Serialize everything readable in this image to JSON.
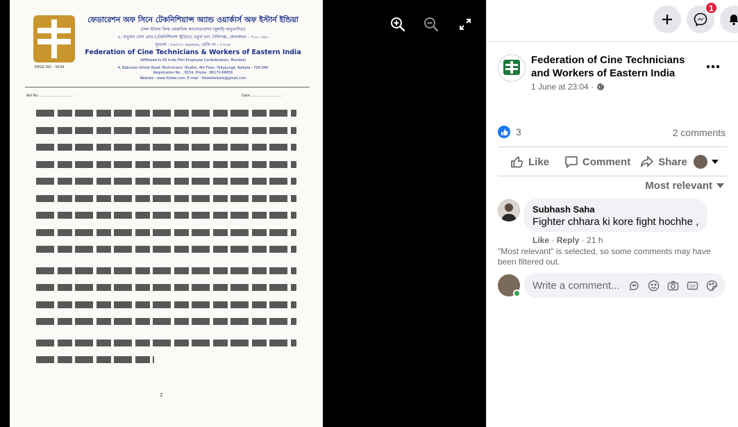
{
  "document": {
    "regd_no": "REGD NO. : 8154",
    "heading_bengali": "ফেডারেশন অফ সিনে টেকনিশিয়ান্স অ্যান্ড ওয়ার্কার্স অফ ইস্টার্ন ইন্ডিয়া",
    "heading_bengali_sub": "(অল ইন্ডিয়া ফিল্ম এমপ্লয়িজ কনফেডারেশন (মুম্বাই) অনুমোদিত)",
    "address_bengali": "৪, বাবুরাম ঘোষ রোড (টেকনিশিয়ান্স স্টুডিও), চতুর্থ তল, টালিগঞ্জ, কোলকাতা - ৭০০ ০৪০",
    "phone_bengali": "দূরভাষ : ৮৬১৭০ ৬৬৬৬৬, রেজি নং - ৮১৫৪",
    "heading_english": "Federation of Cine Technicians & Workers of Eastern India",
    "affiliation": "(Affiliated to All India Film Employee Confederation, Mumbai)",
    "address_english": "4, Baburam Ghosh Road (Technicians' Studio), 4th Floor, Tollygunge, Kolkata - 700 040",
    "registration": "Registration No. : 8154, Phone : 86170 66656",
    "website": "Website : www.fctwei.com, E-mail : fctweikolkata@gmail.com",
    "ref_no_label": "Ref No................................",
    "date_label": "Date ............................",
    "page_number": "2"
  },
  "viewer": {
    "zoom_in_icon": "zoom-in-icon",
    "zoom_out_icon": "zoom-out-icon",
    "fullscreen_icon": "expand-icon"
  },
  "topbar": {
    "messenger_badge": "1"
  },
  "post": {
    "page_name": "Federation of Cine Technicians and Workers of Eastern India",
    "timestamp": "1 June at 23:04 ·",
    "like_count": "3",
    "comment_count": "2 comments",
    "actions": {
      "like": "Like",
      "comment": "Comment",
      "share": "Share"
    },
    "sort_label": "Most relevant"
  },
  "comment": {
    "author": "Subhash Saha",
    "text": "Fighter chhara ki kore fight hochhe ,",
    "like_label": "Like",
    "reply_label": "Reply",
    "age": "21 h"
  },
  "filter_notice": "\"Most relevant\" is selected, so some comments may have been filtered out.",
  "composer": {
    "placeholder": "Write a comment..."
  },
  "colors": {
    "facebook_blue": "#1877f2",
    "badge_red": "#e41e3f",
    "document_blue": "#1b2f8a",
    "logo_gold": "#c9962e"
  }
}
